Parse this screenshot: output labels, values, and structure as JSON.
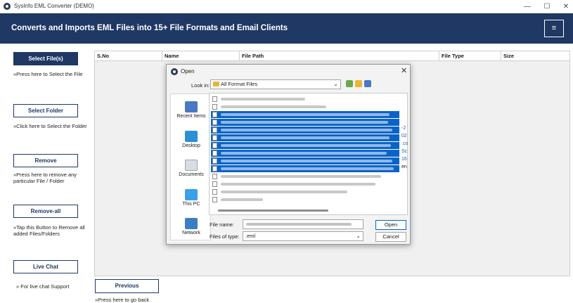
{
  "window": {
    "title": "SysInfo EML Converter (DEMO)",
    "minimize": "—",
    "maximize": "☐",
    "close": "✕"
  },
  "header": {
    "title": "Converts and Imports EML Files into 15+ File Formats and Email Clients",
    "menu_icon": "≡"
  },
  "sidebar": {
    "select_files": {
      "label": "Select File(s)",
      "hint": "»Press here to Select the File"
    },
    "select_folder": {
      "label": "Select Folder",
      "hint": "»Click here to Select the Folder"
    },
    "remove": {
      "label": "Remove",
      "hint": "»Press here to remove any particular File / Folder"
    },
    "remove_all": {
      "label": "Remove-all",
      "hint": "»Tap this Button to Remove all added Files/Folders"
    },
    "live_chat": {
      "label": "Live Chat",
      "hint": "» For live chat Support"
    }
  },
  "table": {
    "columns": [
      "S.No",
      "Name",
      "File Path",
      "File Type",
      "Size"
    ]
  },
  "navigation": {
    "previous_label": "Previous",
    "previous_hint": "»Press here to go back"
  },
  "dialog": {
    "title": "Open",
    "close": "✕",
    "look_in_label": "Look in:",
    "look_in_value": "All Format Files",
    "places": [
      "Recent Items",
      "Desktop",
      "Documents",
      "This PC",
      "Network"
    ],
    "visible_overflow_text": [
      "-2",
      "02",
      ".co",
      "Sc",
      "16",
      "en"
    ],
    "file_name_label": "File name:",
    "file_type_label": "Files of type:",
    "file_type_value": ".eml",
    "open_label": "Open",
    "cancel_label": "Cancel",
    "file_rows_selected": [
      false,
      false,
      true,
      true,
      true,
      true,
      true,
      true,
      true,
      true,
      false,
      false,
      false,
      false
    ]
  },
  "colors": {
    "brand": "#1f3864",
    "selection": "#0a64c8",
    "folder": "#e7b73a"
  }
}
